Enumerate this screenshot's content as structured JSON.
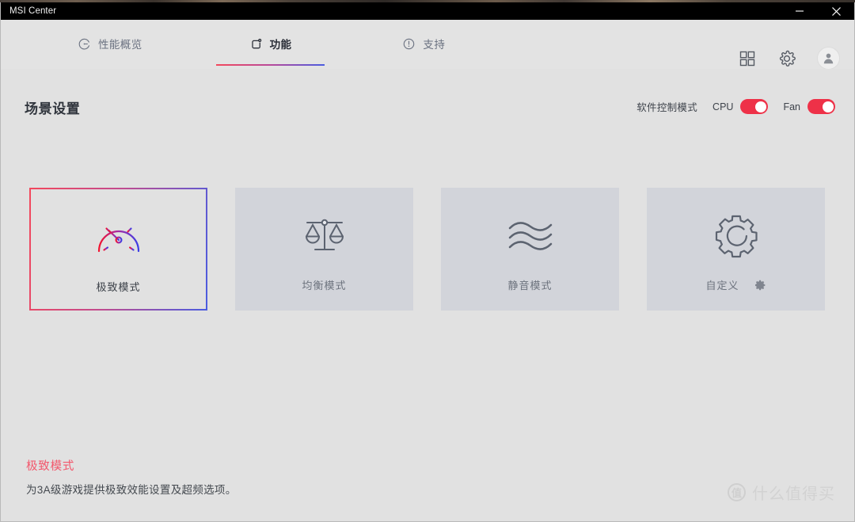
{
  "window": {
    "title": "MSI Center",
    "minimize_label": "–",
    "close_label": "✕"
  },
  "nav": {
    "tabs": [
      {
        "label": "性能概览",
        "icon": "performance-gauge-icon",
        "active": false
      },
      {
        "label": "功能",
        "icon": "features-square-icon",
        "active": true
      },
      {
        "label": "支持",
        "icon": "support-info-icon",
        "active": false
      }
    ],
    "actions": [
      {
        "name": "apps-grid-icon"
      },
      {
        "name": "settings-gear-icon"
      },
      {
        "name": "user-avatar-icon"
      }
    ]
  },
  "main": {
    "section_title": "场景设置",
    "control_mode": {
      "label": "软件控制模式",
      "switches": [
        {
          "name": "CPU",
          "state": "on"
        },
        {
          "name": "Fan",
          "state": "on"
        }
      ]
    },
    "cards": [
      {
        "label": "极致模式",
        "icon": "speedometer-icon",
        "selected": true,
        "has_gear": false
      },
      {
        "label": "均衡模式",
        "icon": "balance-scale-icon",
        "selected": false,
        "has_gear": false
      },
      {
        "label": "静音模式",
        "icon": "sound-waves-icon",
        "selected": false,
        "has_gear": false
      },
      {
        "label": "自定义",
        "icon": "gear-outline-icon",
        "selected": false,
        "has_gear": true
      }
    ]
  },
  "footer": {
    "title": "极致模式",
    "description": "为3A级游戏提供极致效能设置及超频选项。"
  },
  "watermark": {
    "logo_char": "值",
    "text": "什么值得买"
  },
  "colors": {
    "accent_red": "#f3485c",
    "accent_blue": "#4a5ce0",
    "toggle_on": "#ee3148",
    "card_bg": "#d2d4da",
    "page_bg": "#e1e1e1"
  }
}
